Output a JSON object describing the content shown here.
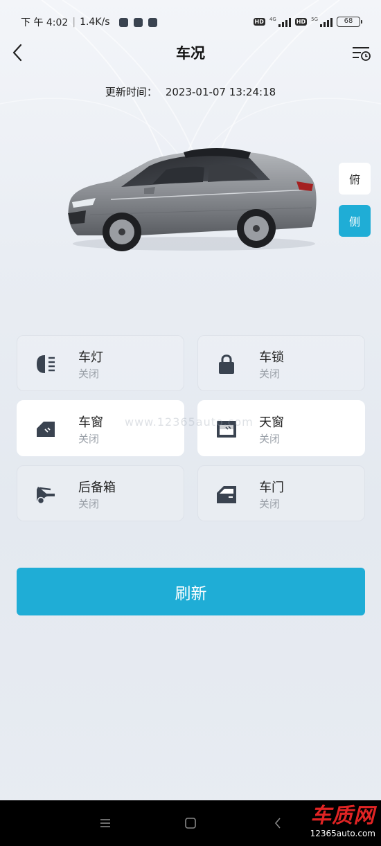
{
  "status_bar": {
    "time": "下 午 4:02",
    "speed": "1.4K/s",
    "hd1": "HD",
    "net1": "4G",
    "hd2": "HD",
    "net2": "5G",
    "battery": "68"
  },
  "header": {
    "title": "车况",
    "back_icon": "chevron-left-icon",
    "history_icon": "list-clock-icon"
  },
  "update": {
    "label": "更新时间：",
    "value": "2023-01-07 13:24:18"
  },
  "view_toggle": {
    "top": "俯",
    "side": "侧",
    "selected": "侧",
    "accent": "#1fadd6"
  },
  "cards": [
    {
      "name": "车灯",
      "state": "关闭",
      "icon": "headlight-icon"
    },
    {
      "name": "车锁",
      "state": "关闭",
      "icon": "lock-icon"
    },
    {
      "name": "车窗",
      "state": "关闭",
      "icon": "car-window-icon"
    },
    {
      "name": "天窗",
      "state": "关闭",
      "icon": "sunroof-icon"
    },
    {
      "name": "后备箱",
      "state": "关闭",
      "icon": "trunk-icon"
    },
    {
      "name": "车门",
      "state": "关闭",
      "icon": "car-door-icon"
    }
  ],
  "watermark": "www.12365auto.com",
  "refresh": {
    "label": "刷新"
  },
  "navbar": {
    "brand": "车质网",
    "brand_url": "12365auto.com",
    "brand_color": "#e02424"
  }
}
